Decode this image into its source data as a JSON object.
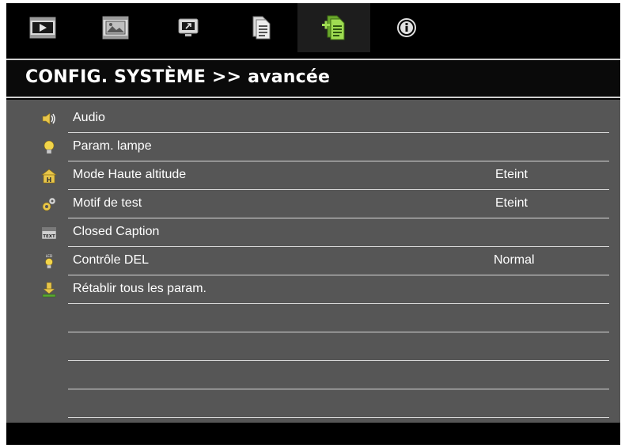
{
  "tabs": [
    {
      "icon": "play-screen-icon",
      "active": false
    },
    {
      "icon": "picture-film-icon",
      "active": false
    },
    {
      "icon": "display-screen-icon",
      "active": false
    },
    {
      "icon": "document-settings-icon",
      "active": false
    },
    {
      "icon": "advanced-document-icon",
      "active": true
    },
    {
      "icon": "info-icon",
      "active": false
    }
  ],
  "header": {
    "title": "CONFIG. SYSTÈME >> avancée"
  },
  "menu": {
    "items": [
      {
        "label": "Audio",
        "value": "",
        "icon": "speaker-icon"
      },
      {
        "label": "Param. lampe",
        "value": "",
        "icon": "lamp-bulb-icon"
      },
      {
        "label": "Mode Haute altitude",
        "value": "Eteint",
        "icon": "high-altitude-icon"
      },
      {
        "label": "Motif de test",
        "value": "Eteint",
        "icon": "gears-icon"
      },
      {
        "label": "Closed Caption",
        "value": "",
        "icon": "text-caption-icon"
      },
      {
        "label": "Contrôle DEL",
        "value": "Normal",
        "icon": "led-bulb-icon"
      },
      {
        "label": "Rétablir tous les param.",
        "value": "",
        "icon": "reset-download-icon"
      }
    ]
  },
  "colors": {
    "active_tab_icon": "#8ccf3c",
    "tab_icon": "#e8e8e8",
    "content_bg": "#565656"
  }
}
